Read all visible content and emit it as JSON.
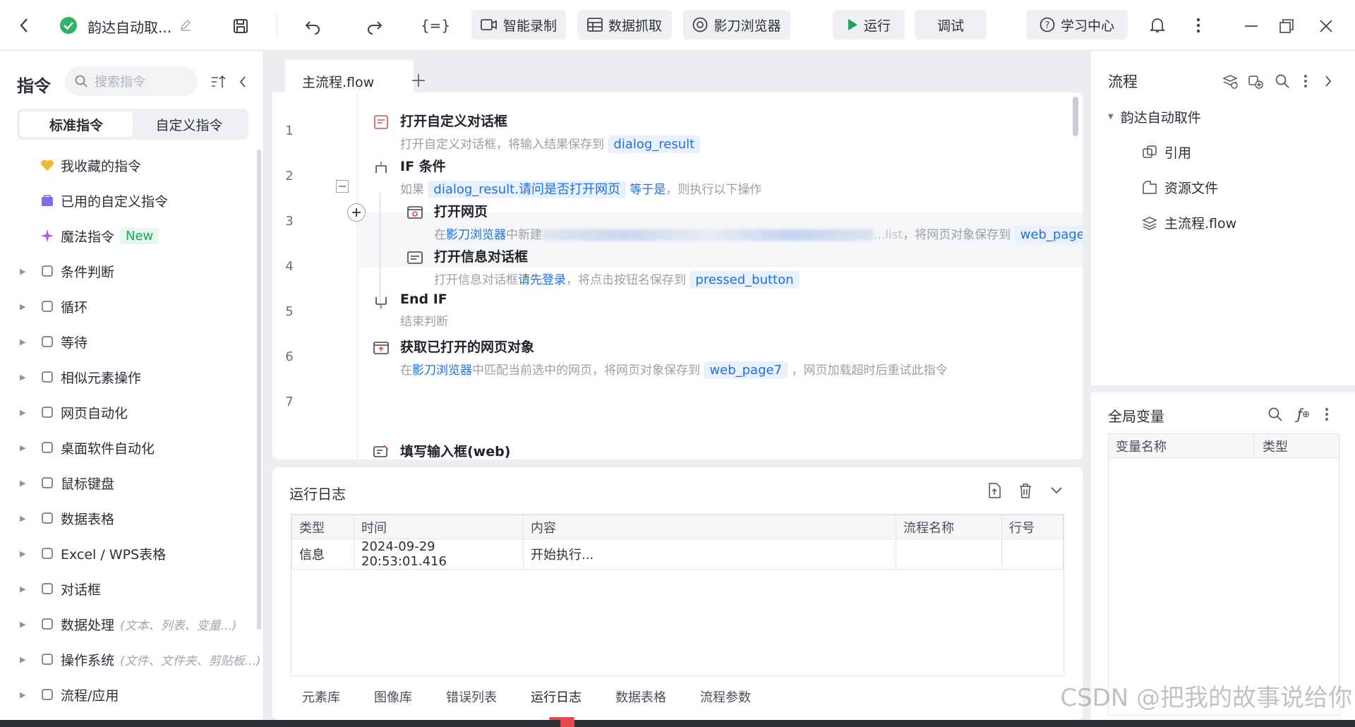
{
  "topbar": {
    "project_name": "韵达自动取...",
    "smart_record": "智能录制",
    "data_capture": "数据抓取",
    "browser": "影刀浏览器",
    "run": "运行",
    "debug": "调试",
    "learning": "学习中心"
  },
  "left": {
    "title": "指令",
    "search_placeholder": "搜索指令",
    "seg_standard": "标准指令",
    "seg_custom": "自定义指令",
    "items": [
      {
        "label": "我收藏的指令",
        "icon": "heart-icon"
      },
      {
        "label": "已用的自定义指令",
        "icon": "bag-icon"
      },
      {
        "label": "魔法指令",
        "icon": "sparkle-icon",
        "badge": "New"
      },
      {
        "label": "条件判断",
        "icon": "branch-icon"
      },
      {
        "label": "循环",
        "icon": "loop-icon"
      },
      {
        "label": "等待",
        "icon": "hourglass-icon"
      },
      {
        "label": "相似元素操作",
        "icon": "copy-icon"
      },
      {
        "label": "网页自动化",
        "icon": "browser-icon"
      },
      {
        "label": "桌面软件自动化",
        "icon": "monitor-icon"
      },
      {
        "label": "鼠标键盘",
        "icon": "cursor-icon"
      },
      {
        "label": "数据表格",
        "icon": "sheet-icon"
      },
      {
        "label": "Excel / WPS表格",
        "icon": "excel-icon"
      },
      {
        "label": "对话框",
        "icon": "dialog-icon"
      },
      {
        "label": "数据处理",
        "icon": "data-icon",
        "hint": "(文本、列表、变量...)"
      },
      {
        "label": "操作系统",
        "icon": "os-icon",
        "hint": "(文件、文件夹、剪贴板...)"
      },
      {
        "label": "流程/应用",
        "icon": "layers-icon"
      }
    ]
  },
  "editor": {
    "tab_name": "主流程.flow",
    "line_numbers": [
      "1",
      "2",
      "3",
      "4",
      "5",
      "6",
      "7"
    ],
    "steps": [
      {
        "title": "打开自定义对话框",
        "desc": "打开自定义对话框，将输入结果保存到",
        "var": "dialog_result"
      },
      {
        "title": "IF 条件",
        "desc_pre": "如果",
        "var": "dialog_result.请问是否打开网页",
        "op": "等于是",
        "desc_post": "，则执行以下操作"
      },
      {
        "title": "打开网页",
        "desc_pre": "在",
        "link": "影刀浏览器",
        "desc_mid": "中新建",
        "desc_blur_tail": "...list",
        "desc_post": "，将网页对象保存到",
        "var": "web_page"
      },
      {
        "title": "打开信息对话框",
        "desc_pre": "打开信息对话框",
        "link": "请先登录",
        "desc_post": "，将点击按钮名保存到",
        "var": "pressed_button"
      },
      {
        "title": "End IF",
        "desc": "结束判断"
      },
      {
        "title": "获取已打开的网页对象",
        "desc_pre": "在",
        "link": "影刀浏览器",
        "desc_mid": "中匹配当前选中的网页，将网页对象保存到",
        "var": "web_page7",
        "desc_post": "，网页加载超时后重试此指令"
      },
      {
        "title": "填写输入框(web)"
      }
    ]
  },
  "log": {
    "title": "运行日志",
    "headers": [
      "类型",
      "时间",
      "内容",
      "流程名称",
      "行号"
    ],
    "rows": [
      {
        "type": "信息",
        "time": "2024-09-29 20:53:01.416",
        "content": "开始执行...",
        "flow": "",
        "line": ""
      }
    ],
    "bottom_tabs": [
      "元素库",
      "图像库",
      "错误列表",
      "运行日志",
      "数据表格",
      "流程参数"
    ],
    "active_tab": "运行日志"
  },
  "right": {
    "flow_title": "流程",
    "tree_root": "韵达自动取件",
    "tree_items": [
      "引用",
      "资源文件",
      "主流程.flow"
    ],
    "global_vars_title": "全局变量",
    "var_headers": [
      "变量名称",
      "类型"
    ]
  },
  "watermark": "CSDN @把我的故事说给你",
  "colors": {
    "accent": "#1f6fe8",
    "run_green": "#19a35b",
    "active_tab_red": "#e5484d"
  }
}
